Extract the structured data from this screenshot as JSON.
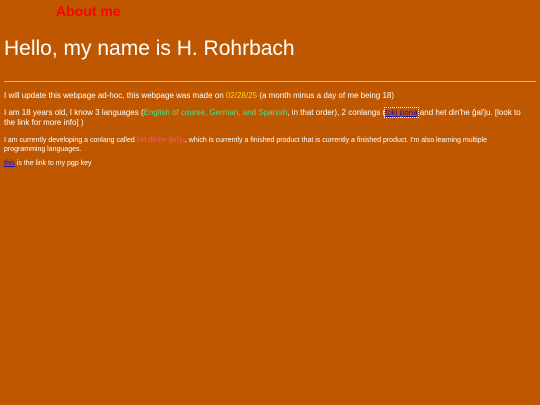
{
  "nav": {
    "title": "About me"
  },
  "heading": "Hello, my name is H. Rohrbach",
  "update": {
    "prefix": "I will update this webpage ad-hoc, this webpage was made on ",
    "date": "02/28/25",
    "suffix": " (a month minus a day of me being 18)"
  },
  "about": {
    "prefix": "I am 18 years old, I know 3 languages (",
    "languages": "English of course, German, and Spanish",
    "middle": ", in that order), 2 conlangs (",
    "conlang_link": "toki pona",
    "suffix": " and het din'he ğal'ju. [look to the link for more info] )"
  },
  "conlang": {
    "prefix": "I am currently developing a conlang called ",
    "name": "het din'he ğal'ju",
    "suffix": ", which is currently a finished product that is currently a finished product. I'm also learning multiple programming languages."
  },
  "pgp": {
    "link_text": "this",
    "suffix": " is the link to my pgp key"
  },
  "colors": {
    "background": "#bf5700",
    "nav_title": "#ff0000",
    "date": "#ffd700",
    "languages": "#4de08c",
    "conlang_name": "#ff4f9a",
    "link": "#1a0dab"
  }
}
